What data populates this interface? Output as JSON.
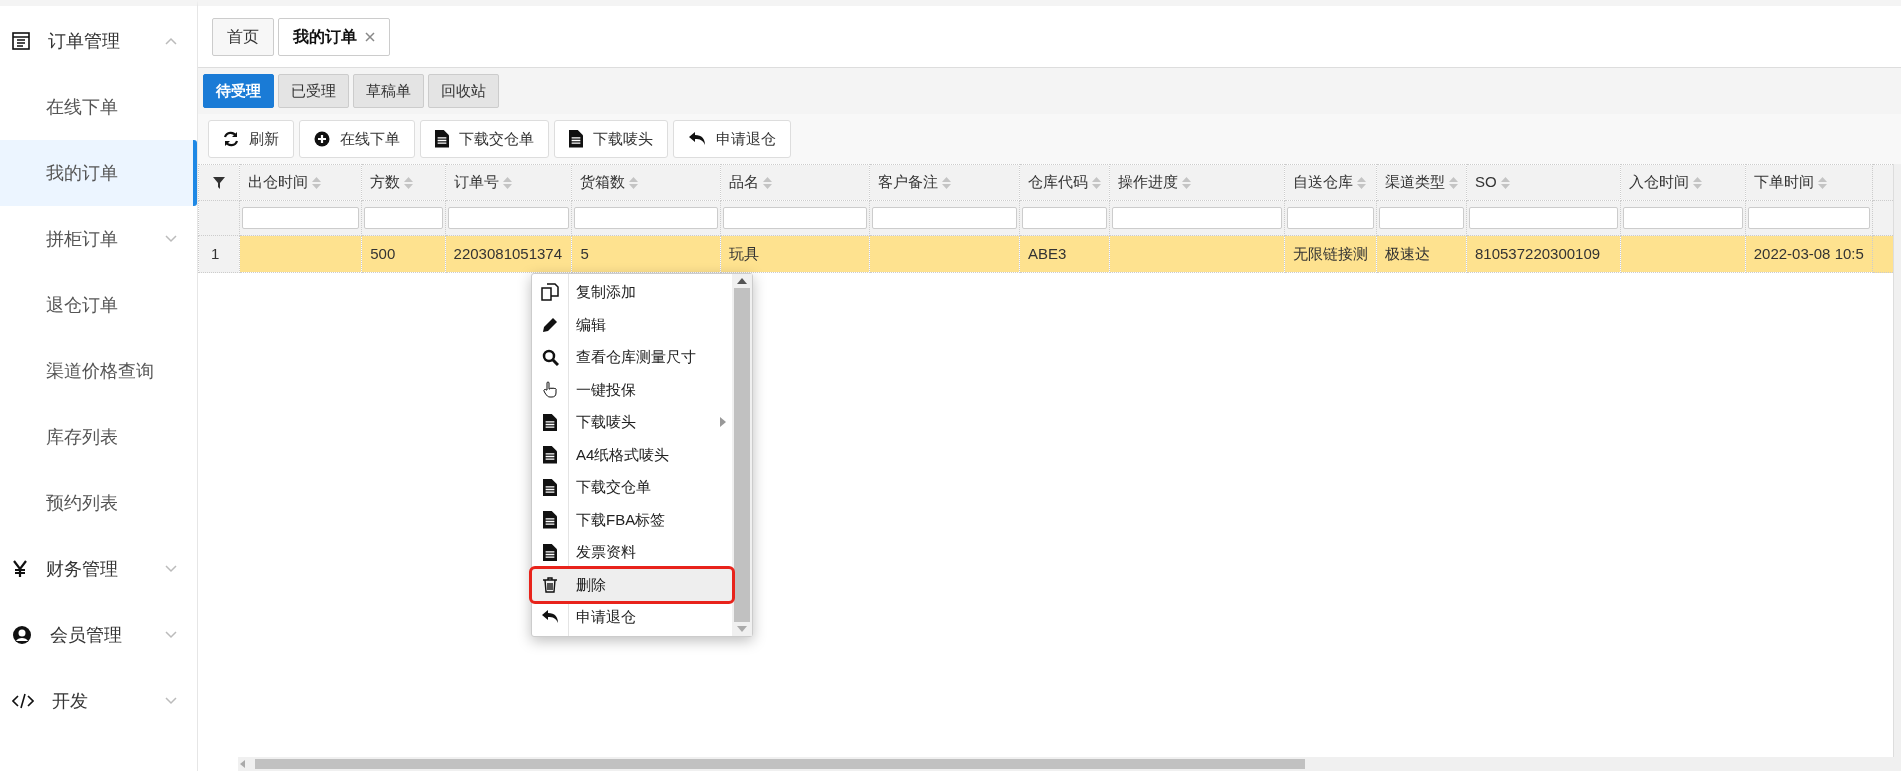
{
  "sidebar": {
    "groups": [
      {
        "label": "订单管理",
        "expanded": true,
        "children": [
          {
            "label": "在线下单",
            "selected": false,
            "has_children": false
          },
          {
            "label": "我的订单",
            "selected": true,
            "has_children": false
          },
          {
            "label": "拼柜订单",
            "selected": false,
            "has_children": true
          },
          {
            "label": "退仓订单",
            "selected": false,
            "has_children": false
          },
          {
            "label": "渠道价格查询",
            "selected": false,
            "has_children": false
          },
          {
            "label": "库存列表",
            "selected": false,
            "has_children": false
          },
          {
            "label": "预约列表",
            "selected": false,
            "has_children": false
          }
        ]
      },
      {
        "label": "财务管理",
        "expanded": false
      },
      {
        "label": "会员管理",
        "expanded": false
      },
      {
        "label": "开发",
        "expanded": false
      }
    ]
  },
  "tabs": [
    {
      "label": "首页",
      "selected": false,
      "closable": false
    },
    {
      "label": "我的订单",
      "selected": true,
      "closable": true
    }
  ],
  "status_tabs": [
    {
      "label": "待受理",
      "selected": true
    },
    {
      "label": "已受理",
      "selected": false
    },
    {
      "label": "草稿单",
      "selected": false
    },
    {
      "label": "回收站",
      "selected": false
    }
  ],
  "toolbar": [
    "刷新",
    "在线下单",
    "下载交仓单",
    "下载唛头",
    "申请退仓"
  ],
  "table": {
    "columns": [
      "出仓时间",
      "方数",
      "订单号",
      "货箱数",
      "品名",
      "客户备注",
      "仓库代码",
      "操作进度",
      "自送仓库",
      "渠道类型",
      "SO",
      "入仓时间",
      "下单时间"
    ],
    "rows": [
      {
        "number": "1",
        "selected": true,
        "cells": [
          "",
          "500",
          "2203081051374",
          "5",
          "玩具",
          "",
          "ABE3",
          "",
          "无限链接测",
          "极速达",
          "810537220300109",
          "",
          "2022-03-08 10:5"
        ]
      }
    ]
  },
  "context_menu": {
    "items": [
      {
        "label": "复制添加",
        "has_submenu": false,
        "highlighted": false
      },
      {
        "label": "编辑",
        "has_submenu": false,
        "highlighted": false
      },
      {
        "label": "查看仓库测量尺寸",
        "has_submenu": false,
        "highlighted": false
      },
      {
        "label": "一键投保",
        "has_submenu": false,
        "highlighted": false
      },
      {
        "label": "下载唛头",
        "has_submenu": true,
        "highlighted": false
      },
      {
        "label": "A4纸格式唛头",
        "has_submenu": false,
        "highlighted": false
      },
      {
        "label": "下载交仓单",
        "has_submenu": false,
        "highlighted": false
      },
      {
        "label": "下载FBA标签",
        "has_submenu": false,
        "highlighted": false
      },
      {
        "label": "发票资料",
        "has_submenu": false,
        "highlighted": false
      },
      {
        "label": "删除",
        "has_submenu": false,
        "highlighted": true
      },
      {
        "label": "申请退仓",
        "has_submenu": false,
        "highlighted": false
      }
    ]
  }
}
